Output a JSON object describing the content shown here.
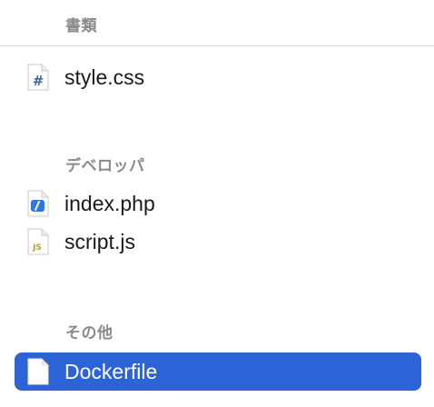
{
  "sections": [
    {
      "header": "書類",
      "items": [
        {
          "label": "style.css",
          "icon": "css-file-icon",
          "selected": false
        }
      ]
    },
    {
      "header": "デベロッパ",
      "items": [
        {
          "label": "index.php",
          "icon": "php-file-icon",
          "selected": false
        },
        {
          "label": "script.js",
          "icon": "js-file-icon",
          "selected": false
        }
      ]
    },
    {
      "header": "その他",
      "items": [
        {
          "label": "Dockerfile",
          "icon": "generic-file-icon",
          "selected": true
        }
      ]
    }
  ],
  "icon_glyphs": {
    "css": "#",
    "js": "JS"
  },
  "colors": {
    "selection": "#2c64d8",
    "header_text": "#8a8a8a",
    "divider": "#d9d9d9"
  }
}
